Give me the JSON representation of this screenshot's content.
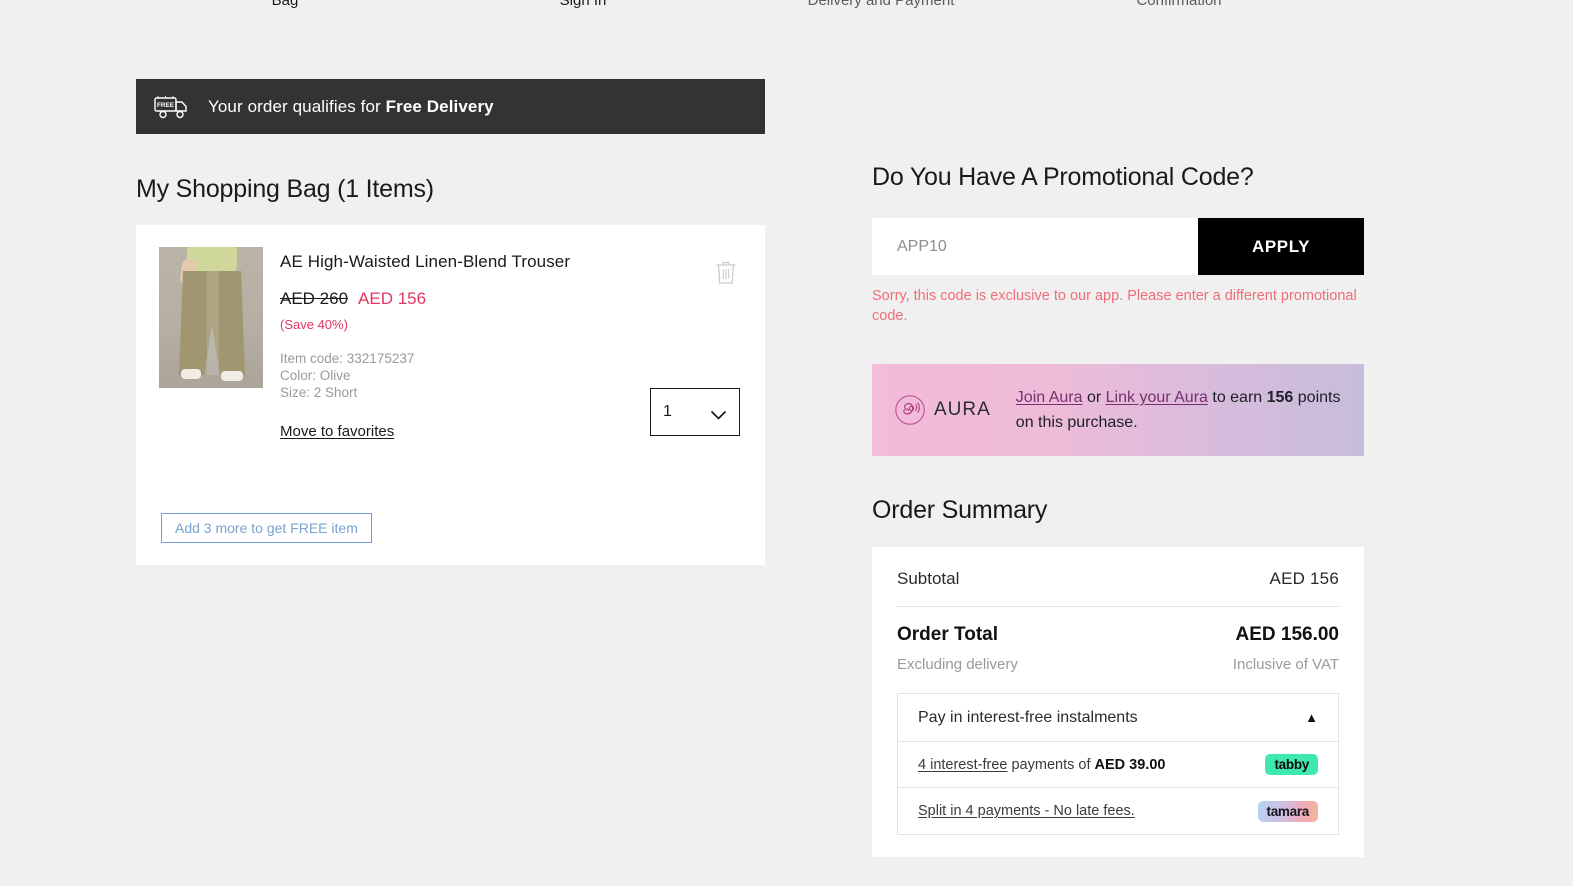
{
  "checkout_progress": {
    "steps": [
      {
        "label": "Bag",
        "state": "current"
      },
      {
        "label": "Sign In",
        "state": "upcoming"
      },
      {
        "label": "Delivery and Payment",
        "state": "upcoming"
      },
      {
        "label": "Confirmation",
        "state": "upcoming"
      }
    ],
    "bar_color": "#bcdcbc"
  },
  "free_delivery_banner": {
    "icon": "free-delivery-truck-icon",
    "text_prefix": "Your order qualifies for ",
    "text_strong": "Free Delivery",
    "background": "#333333"
  },
  "bag": {
    "title": "My Shopping Bag (1 Items)",
    "items": [
      {
        "name": "AE High-Waisted Linen-Blend Trouser",
        "price_original": "AED  260",
        "price_current": "AED  156",
        "save_label": "(Save 40%)",
        "item_code": "Item code: 332175237",
        "color": "Color: Olive",
        "size": "Size: 2 Short",
        "move_to_favorites": "Move to favorites",
        "quantity": "1",
        "remove_icon": "trash-icon"
      }
    ],
    "free_item_button": "Add 3 more to get FREE item"
  },
  "promo": {
    "title": "Do You Have A Promotional Code?",
    "input_value": "",
    "input_placeholder": "APP10",
    "apply_label": "APPLY",
    "error": "Sorry, this code is exclusive to our app. Please enter a different promotional code.",
    "error_color": "#f06e79"
  },
  "aura": {
    "brand": "AURA",
    "logo_icon": "aura-logo-icon",
    "join_link": "Join Aura",
    "or_text": " or ",
    "link_link": "Link your Aura",
    "earn_prefix": " to earn ",
    "points": "156",
    "earn_suffix": " points on this purchase."
  },
  "order_summary": {
    "title": "Order Summary",
    "subtotal_label": "Subtotal",
    "subtotal_value": "AED 156",
    "total_label": "Order Total",
    "total_value": "AED 156.00",
    "excluding_label": "Excluding delivery",
    "vat_label": "Inclusive of VAT",
    "instalments": {
      "header": "Pay in interest-free instalments",
      "expanded": true,
      "caret": "▲",
      "options": [
        {
          "link_text": "4 interest-free",
          "text_middle": " payments of ",
          "amount": "AED 39.00",
          "provider": "tabby",
          "provider_color": "#3fe8b0"
        },
        {
          "link_text": "Split in 4 payments - No late fees.",
          "text_middle": "",
          "amount": "",
          "provider": "tamara",
          "provider_color": "#cdbfe3"
        }
      ]
    }
  }
}
